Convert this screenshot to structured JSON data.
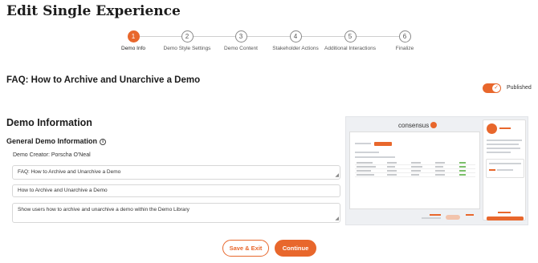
{
  "page": {
    "title": "Edit Single Experience"
  },
  "stepper": {
    "steps": [
      {
        "number": "1",
        "label": "Demo Info",
        "active": true
      },
      {
        "number": "2",
        "label": "Demo Style Settings",
        "active": false
      },
      {
        "number": "3",
        "label": "Demo Content",
        "active": false
      },
      {
        "number": "4",
        "label": "Stakeholder Actions",
        "active": false
      },
      {
        "number": "5",
        "label": "Additional Interactions",
        "active": false
      },
      {
        "number": "6",
        "label": "Finalize",
        "active": false
      }
    ]
  },
  "header": {
    "faq_title": "FAQ: How to Archive and Unarchive a Demo",
    "published_label": "Published",
    "published_on": true
  },
  "demo_info": {
    "section_title": "Demo Information",
    "general_title": "General Demo Information",
    "info_icon": "info-icon",
    "creator": "Demo Creator: Porscha O'Neal",
    "field_internal_name": "FAQ: How to Archive and Unarchive a Demo",
    "field_title": "How to Archive and Unarchive a Demo",
    "field_description": "Show users how to archive and unarchive a demo within the Demo Library"
  },
  "preview": {
    "brand": "consensus"
  },
  "actions": {
    "save_exit": "Save & Exit",
    "continue": "Continue"
  },
  "colors": {
    "accent": "#e8672c"
  }
}
